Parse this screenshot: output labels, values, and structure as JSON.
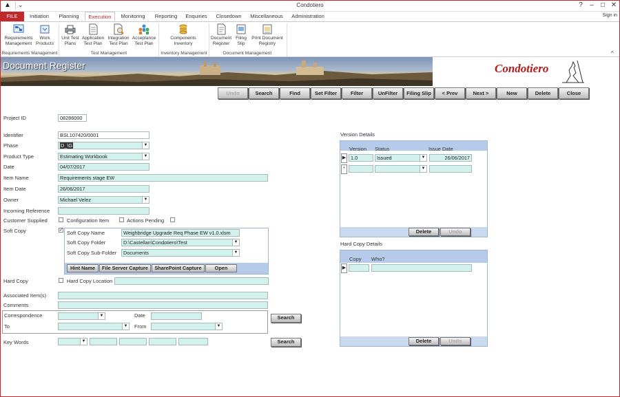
{
  "window": {
    "title": "Condotiero",
    "help": "?",
    "restore": "–",
    "minimize": "—",
    "maximize": "□",
    "close": "✕",
    "sign_in": "Sign in"
  },
  "tabs": [
    "FILE",
    "Initiation",
    "Planning",
    "Execution",
    "Monitoring",
    "Reporting",
    "Enquiries",
    "Closedown",
    "Miscellaneous",
    "Administration"
  ],
  "ribbon": {
    "groups": [
      {
        "label": "Requirements Management",
        "buttons": [
          {
            "line1": "Requirements",
            "line2": "Management",
            "icon": "requirements-icon"
          },
          {
            "line1": "Work",
            "line2": "Products",
            "icon": "work-products-icon"
          }
        ]
      },
      {
        "label": "Test Management",
        "buttons": [
          {
            "line1": "Unit Test",
            "line2": "Plans",
            "icon": "printer-icon"
          },
          {
            "line1": "Application",
            "line2": "Test Plan",
            "icon": "document-icon"
          },
          {
            "line1": "Integration",
            "line2": "Test Plan",
            "icon": "magnifier-document-icon"
          },
          {
            "line1": "Acceptance",
            "line2": "Test Plan",
            "icon": "people-icon"
          }
        ]
      },
      {
        "label": "Inventory Management",
        "buttons": [
          {
            "line1": "Components",
            "line2": "Inventory",
            "icon": "coins-icon"
          }
        ]
      },
      {
        "label": "Document Management",
        "buttons": [
          {
            "line1": "Document",
            "line2": "Register",
            "icon": "document-register-icon"
          },
          {
            "line1": "Filing",
            "line2": "Slip",
            "icon": "filing-slip-icon"
          },
          {
            "line1": "Print Document",
            "line2": "Registry",
            "icon": "print-registry-icon"
          }
        ]
      }
    ],
    "collapse": "^"
  },
  "banner": {
    "heading": "Document Register",
    "logo": "Condotiero"
  },
  "toolbar": [
    "Undo",
    "Search",
    "Find",
    "Set Filter",
    "Filter",
    "UnFilter",
    "Filing Slip",
    "< Prev",
    "Next >",
    "New",
    "Delete",
    "Close"
  ],
  "form": {
    "project_id_label": "Project ID",
    "project_id": "08286000",
    "identifier_label": "Identifier",
    "identifier": "BSL107420/0001",
    "phase_label": "Phase",
    "phase": "D_\\G",
    "product_type_label": "Product Type",
    "product_type": "Estimating Workbook",
    "date_label": "Date",
    "date": "04/07/2017",
    "item_name_label": "Item Name",
    "item_name": "Requirements stage EW",
    "item_date_label": "Item Date",
    "item_date": "26/06/2017",
    "owner_label": "Owner",
    "owner": "Michael Velez",
    "incoming_label": "Incoming Reference",
    "incoming": "",
    "customer_supplied_label": "Customer Supplied",
    "config_item_label": "Configuration Item",
    "actions_pending_label": "Actions Pending",
    "soft_copy_label": "Soft Copy",
    "soft_copy_name_label": "Soft Copy Name",
    "soft_copy_name": "Weighbridge Upgrade Req Phase EW v1.0.xlsm",
    "soft_copy_folder_label": "Soft Copy Folder",
    "soft_copy_folder": "D:\\Castellan\\Condotiero\\Test",
    "soft_copy_sub_label": "Soft Copy Sub-Folder",
    "soft_copy_sub": "Documents",
    "soft_buttons": [
      "Hint Name",
      "File Server Capture",
      "SharePoint Capture",
      "Open"
    ],
    "hard_copy_label": "Hard Copy",
    "hard_copy_location_label": "Hard Copy Location",
    "associated_label": "Associated Item(s)",
    "comments_label": "Comments",
    "correspondence_label": "Correspondence",
    "to_label": "To",
    "corr_date_label": "Date",
    "from_label": "From",
    "search_label": "Search",
    "keywords_label": "Key Words"
  },
  "version_details": {
    "title": "Version Details",
    "columns": [
      "Version",
      "Status",
      "Issue Date"
    ],
    "rows": [
      {
        "version": "1.0",
        "status": "Issued",
        "issue_date": "26/06/2017"
      }
    ],
    "delete": "Delete",
    "undo": "Undo"
  },
  "hard_copy_details": {
    "title": "Hard Copy Details",
    "columns": [
      "Copy",
      "Who?"
    ],
    "delete": "Delete",
    "undo": "Undo"
  },
  "colors": {
    "accent": "#c0282d",
    "field": "#d4f2ed",
    "panel_header": "#b6cbea"
  }
}
